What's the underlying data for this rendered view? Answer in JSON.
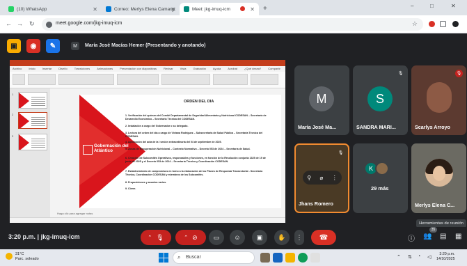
{
  "browser": {
    "tabs": [
      {
        "label": "(10) WhatsApp",
        "color": "#25d366"
      },
      {
        "label": "Correo: Merlys Elena Camargo",
        "color": "#0078d4"
      },
      {
        "label": "Meet: jkg-imuq-icm",
        "color": "#00897b"
      }
    ],
    "new_tab": "+",
    "controls": {
      "minimize": "–",
      "maximize": "□",
      "close": "✕"
    },
    "url": "meet.google.com/jkg-imuq-icm"
  },
  "presenter": {
    "avatar_letter": "M",
    "text": "María José Macías Hemer (Presentando y anotando)"
  },
  "ppt": {
    "menu": [
      "Archivo",
      "Inicio",
      "Insertar",
      "Diseño",
      "Transiciones",
      "Animaciones",
      "Presentación con diapositivas",
      "Revisar",
      "Vista",
      "Grabación",
      "Ayuda",
      "Acrobat",
      "¿Qué desea?",
      "Compartir"
    ],
    "thumbs": [
      "1",
      "2",
      "3"
    ],
    "notes_hint": "Haga clic para agregar notas",
    "logo_text": "Gobernación del Atlántico",
    "slide_heading": "ORDEN DEL DIA",
    "agenda": [
      "1. Verificación del quórum del Comité Departamental de Seguridad Alimentaria y Nutricional CODESAN – Secretaría de Desarrollo Económico – Secretaria Técnica del CODESAN.",
      "2. Instalación a cargo del Gobernador o su delegado.",
      "3. Lectura del orden del día a cargo de Viviana Rodríguez – Subsecretaria de Salud Pública – Secretaria Técnica del CODESAN.",
      "4. Aprobación del acta de la I sesión extraordinaria del 04 de septiembre de 2025.",
      "5. Zonas de Recuperación Nutricional – Contexto Normativo – Decreto 053 de 2024 – Secretaría de Salud.",
      "6. Creación de Subcomités Operativos, responsables y funciones, en función de la Resolución conjunta 1325 de 19 de junio de 2025 y el Decreto 053 de 2024 – Secretaría Técnica y Coordinación CODESAN.",
      "7. Establecimiento de compromisos en torno a la elaboración de los Planes de Respuesta Transectorial - Secretaría Técnica, Coordinación CODESAN y miembros de los Subcomités.",
      "8. Proposiciones y asuntos varios.",
      "9. Cierre."
    ]
  },
  "participants": [
    {
      "name": "María José Ma...",
      "initial": "M",
      "color": "#5f6368"
    },
    {
      "name": "SANDRA MARI...",
      "initial": "S",
      "color": "#00897b"
    },
    {
      "name": "Scarlys Arroyo"
    },
    {
      "name": "Jhans Romero"
    },
    {
      "more_label": "29 más",
      "avatar_letter": "K"
    },
    {
      "name": "Merlys Elena C..."
    }
  ],
  "tooltip": "Herramientas de reunión",
  "meet": {
    "clock": "3:20 p.m.",
    "separator": "|",
    "meeting_code": "jkg-imuq-icm",
    "participants_badge": "35"
  },
  "taskbar": {
    "temperature": "31°C",
    "weather": "Parc. soleado",
    "search_placeholder": "Buscar",
    "time": "3:20 p.m.",
    "date": "14/10/2025"
  },
  "colors": {
    "accent_orange": "#f28b30",
    "end_call": "#d93025",
    "ppt_red": "#c43e1c"
  }
}
